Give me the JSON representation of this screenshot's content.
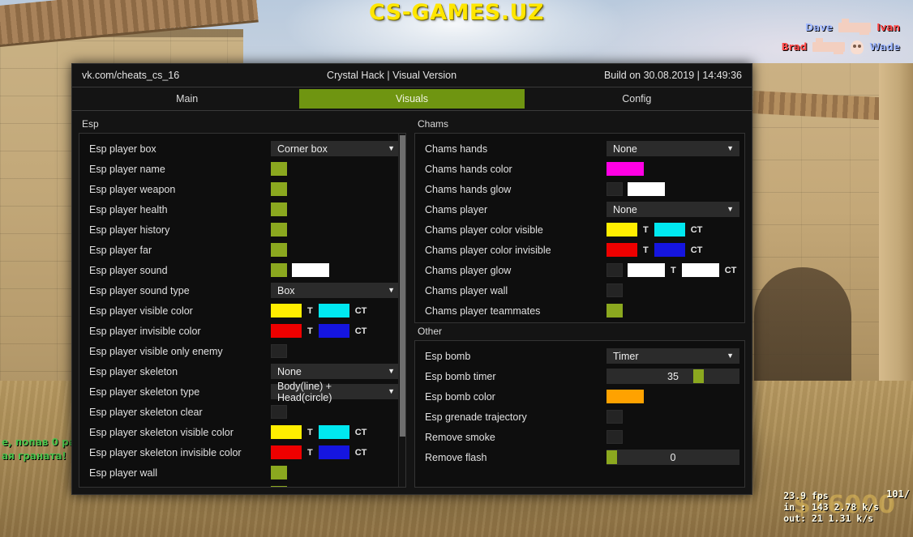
{
  "game_bg": {
    "banner_text": "CS-GAMES.UZ",
    "killfeed": [
      {
        "attacker": "Dave",
        "attacker_team": "ct",
        "weapon": "rifle-icon",
        "headshot": false,
        "victim": "Ivan",
        "victim_team": "t"
      },
      {
        "attacker": "Brad",
        "attacker_team": "t",
        "weapon": "rifle-icon",
        "headshot": true,
        "victim": "Wade",
        "victim_team": "ct"
      }
    ],
    "hud": {
      "fps": "23.9 fps",
      "net_in": "in :  143 2.78 k/s",
      "net_out": "out:  21 1.31 k/s",
      "ammo": "101/",
      "money": "$16000",
      "radio_line1": "е, попав 0 ра",
      "radio_line2": "ая граната!"
    }
  },
  "window": {
    "title_left": "vk.com/cheats_cs_16",
    "title_center": "Crystal Hack | Visual Version",
    "title_right": "Build on 30.08.2019 | 14:49:36",
    "tabs": [
      {
        "label": "Main",
        "active": false
      },
      {
        "label": "Visuals",
        "active": true
      },
      {
        "label": "Config",
        "active": false
      }
    ]
  },
  "colors": {
    "accent_green": "#6f9511",
    "checkbox_green": "#8ba81f",
    "yellow": "#ffee00",
    "cyan": "#00e8f0",
    "red": "#ee0000",
    "blue": "#1515e0",
    "magenta": "#ff00e4",
    "white": "#ffffff",
    "orange": "#ffa200"
  },
  "esp": {
    "title": "Esp",
    "rows": [
      {
        "label": "Esp player box",
        "type": "combo",
        "value": "Corner box"
      },
      {
        "label": "Esp player name",
        "type": "check",
        "checked": true
      },
      {
        "label": "Esp player weapon",
        "type": "check",
        "checked": true
      },
      {
        "label": "Esp player health",
        "type": "check",
        "checked": true
      },
      {
        "label": "Esp player history",
        "type": "check",
        "checked": true
      },
      {
        "label": "Esp player far",
        "type": "check",
        "checked": true
      },
      {
        "label": "Esp player sound",
        "type": "check-color",
        "checked": true,
        "color": "#ffffff"
      },
      {
        "label": "Esp player sound type",
        "type": "combo",
        "value": "Box"
      },
      {
        "label": "Esp player visible color",
        "type": "team-colors",
        "t_color": "#ffee00",
        "ct_color": "#00e8f0",
        "t_label": "T",
        "ct_label": "CT"
      },
      {
        "label": "Esp player invisible color",
        "type": "team-colors",
        "t_color": "#ee0000",
        "ct_color": "#1515e0",
        "t_label": "T",
        "ct_label": "CT"
      },
      {
        "label": "Esp player visible only enemy",
        "type": "check",
        "checked": false
      },
      {
        "label": "Esp player skeleton",
        "type": "combo",
        "value": "None"
      },
      {
        "label": "Esp player skeleton type",
        "type": "combo",
        "value": "Body(line) + Head(circle)"
      },
      {
        "label": "Esp player skeleton clear",
        "type": "check",
        "checked": false
      },
      {
        "label": "Esp player skeleton visible color",
        "type": "team-colors",
        "t_color": "#ffee00",
        "ct_color": "#00e8f0",
        "t_label": "T",
        "ct_label": "CT"
      },
      {
        "label": "Esp player skeleton invisible color",
        "type": "team-colors",
        "t_color": "#ee0000",
        "ct_color": "#1515e0",
        "t_label": "T",
        "ct_label": "CT"
      },
      {
        "label": "Esp player wall",
        "type": "check",
        "checked": true
      },
      {
        "label": "",
        "type": "check",
        "checked": true
      }
    ],
    "scrollbar": {
      "visible": true
    }
  },
  "chams": {
    "title": "Chams",
    "rows": [
      {
        "label": "Chams hands",
        "type": "combo",
        "value": "None"
      },
      {
        "label": "Chams hands color",
        "type": "color",
        "color": "#ff00e4"
      },
      {
        "label": "Chams hands glow",
        "type": "check-color",
        "checked": false,
        "color": "#ffffff"
      },
      {
        "label": "Chams player",
        "type": "combo",
        "value": "None"
      },
      {
        "label": "Chams player color visible",
        "type": "team-colors",
        "t_color": "#ffee00",
        "ct_color": "#00e8f0",
        "t_label": "T",
        "ct_label": "CT"
      },
      {
        "label": "Chams player color invisible",
        "type": "team-colors",
        "t_color": "#ee0000",
        "ct_color": "#1515e0",
        "t_label": "T",
        "ct_label": "CT"
      },
      {
        "label": "Chams player glow",
        "type": "check-team-colors",
        "checked": false,
        "t_color": "#ffffff",
        "ct_color": "#ffffff",
        "t_label": "T",
        "ct_label": "CT"
      },
      {
        "label": "Chams player wall",
        "type": "check",
        "checked": false
      },
      {
        "label": "Chams player teammates",
        "type": "check",
        "checked": true
      }
    ]
  },
  "other": {
    "title": "Other",
    "rows": [
      {
        "label": "Esp bomb",
        "type": "combo",
        "value": "Timer"
      },
      {
        "label": "Esp bomb timer",
        "type": "slider",
        "value": "35",
        "percent": 71
      },
      {
        "label": "Esp bomb color",
        "type": "color",
        "color": "#ffa200"
      },
      {
        "label": "Esp grenade trajectory",
        "type": "check",
        "checked": false
      },
      {
        "label": "Remove smoke",
        "type": "check",
        "checked": false
      },
      {
        "label": "Remove flash",
        "type": "slider",
        "value": "0",
        "percent": 0
      }
    ]
  }
}
